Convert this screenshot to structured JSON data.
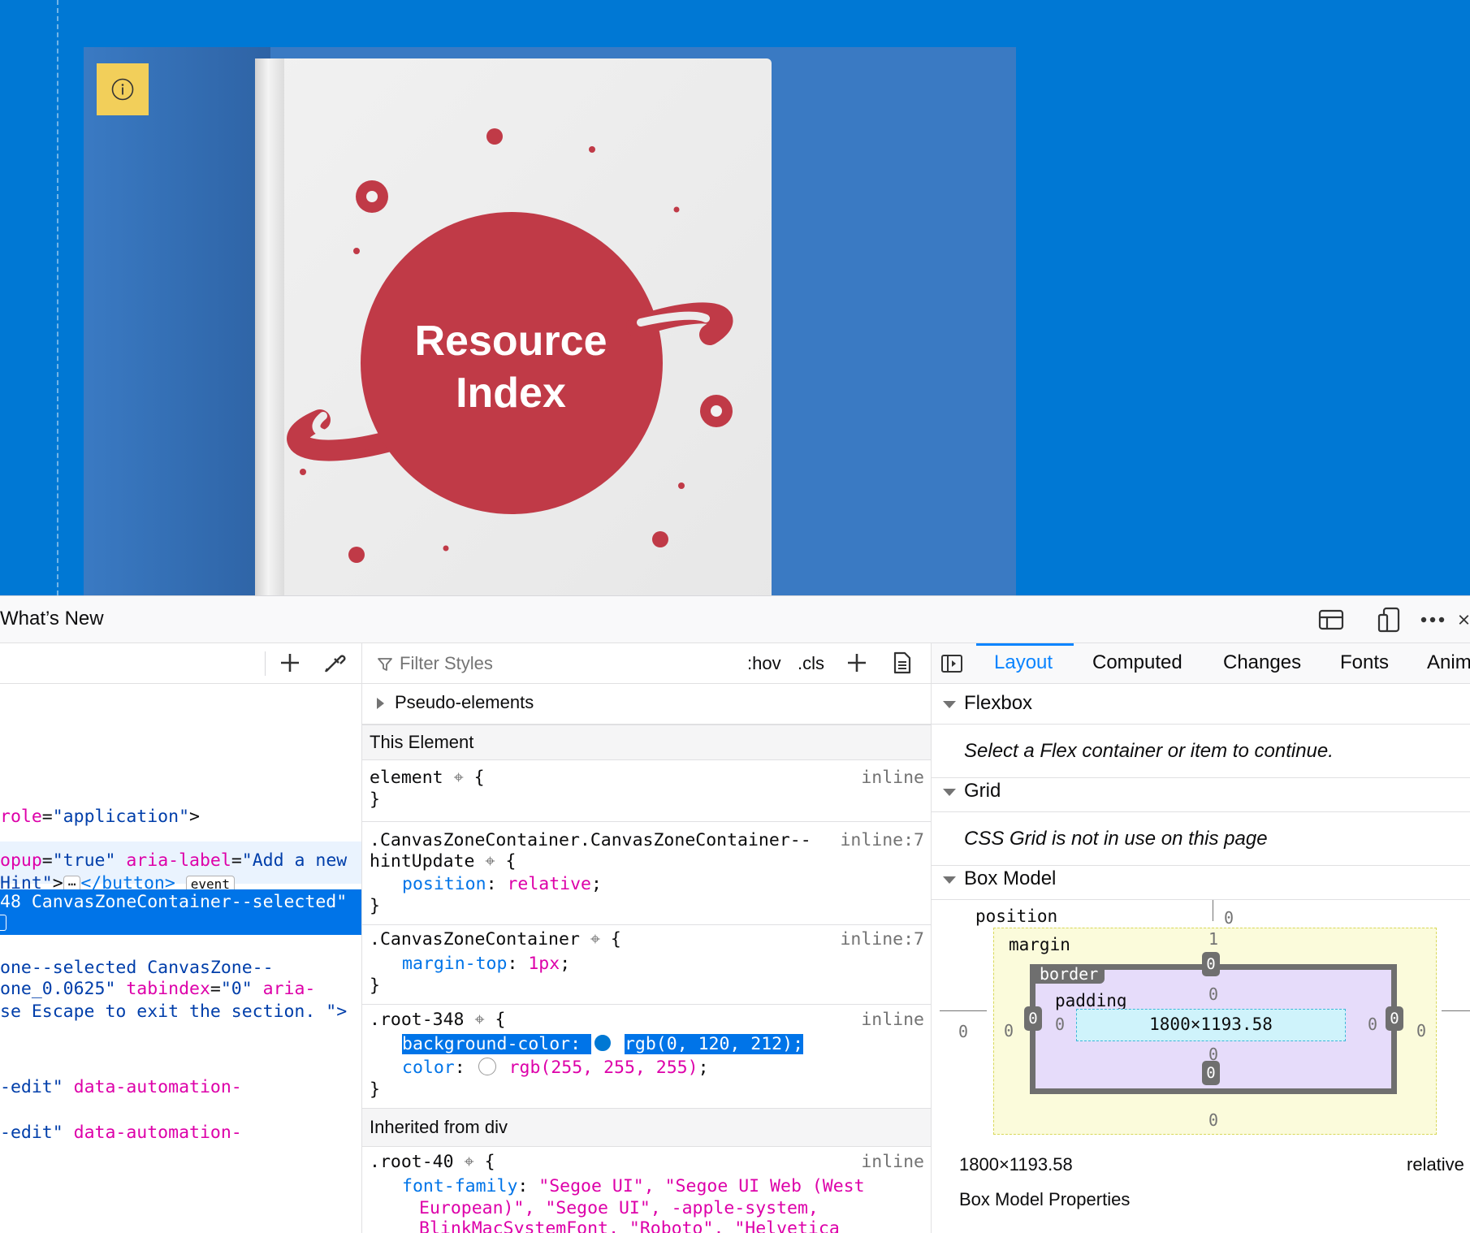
{
  "page": {
    "book_title_line1": "Resource",
    "book_title_line2": "Index",
    "hint_icon": "info-icon"
  },
  "toolbar": {
    "whats_new": "What’s New",
    "icons": [
      "dock-layout-icon",
      "responsive-design-icon",
      "more-options-icon",
      "close-icon"
    ]
  },
  "markup": {
    "lines": {
      "l1_attr": "role",
      "l1_val": "\"application\"",
      "l2_attr_a": "opup",
      "l2_val_a": "\"true\"",
      "l2_attr_b": "aria-label",
      "l2_val_b": "\"Add a new",
      "l3_val": "Hint\"",
      "l3_tag_close": "</button>",
      "l3_badge": "event",
      "l4_text": "48 CanvasZoneContainer--selected\"",
      "l5_val": "one--selected CanvasZone--",
      "l6_val": "one_0.0625\"",
      "l6_attr": "tabindex",
      "l6_val2": "\"0\"",
      "l6_attr2": "aria-",
      "l7_val": "se Escape to exit the section. \">",
      "l8_val": "-edit\"",
      "l8_attr": "data-automation-",
      "l9_val": "-edit\"",
      "l9_attr": "data-automation-"
    }
  },
  "rules": {
    "filter_placeholder": "Filter Styles",
    "hov": ":hov",
    "cls": ".cls",
    "pseudo_elements": "Pseudo-elements",
    "this_element": "This Element",
    "inherited": "Inherited from div",
    "r1_selector": "element",
    "r1_origin": "inline",
    "r2_selector_a": ".CanvasZoneContainer.CanvasZoneContainer--",
    "r2_selector_b": "hintUpdate",
    "r2_origin": "inline:7",
    "r2_prop": "position",
    "r2_val": "relative",
    "r3_selector": ".CanvasZoneContainer",
    "r3_origin": "inline:7",
    "r3_prop": "margin-top",
    "r3_val": "1px",
    "r4_selector": ".root-348",
    "r4_origin": "inline",
    "r4_prop1": "background-color:",
    "r4_val1": "rgb(0, 120, 212);",
    "r4_prop2": "color",
    "r4_val2": "rgb(255, 255, 255)",
    "r5_selector": ".root-40",
    "r5_origin": "inline",
    "r5_prop": "font-family",
    "r5_val_l1": "\"Segoe UI\", \"Segoe UI Web (West",
    "r5_val_l2": "European)\", \"Segoe UI\", -apple-system,",
    "r5_val_l3": "BlinkMacSystemFont, \"Roboto\", \"Helvetica",
    "swatch_bg": "#0078d4",
    "swatch_color": "#ffffff"
  },
  "layout": {
    "tabs": [
      "Layout",
      "Computed",
      "Changes",
      "Fonts",
      "Anim"
    ],
    "active_tab": "Layout",
    "flexbox": "Flexbox",
    "flexbox_msg": "Select a Flex container or item to continue.",
    "grid": "Grid",
    "grid_msg": "CSS Grid is not in use on this page",
    "box_model": "Box Model",
    "bm_position": "position",
    "bm_margin": "margin",
    "bm_border": "border",
    "bm_padding": "padding",
    "bm_content": "1800×1193.58",
    "bm_margin_top": "1",
    "bm_zero": "0",
    "footer_size": "1800×1193.58",
    "footer_position": "relative",
    "footer_cut": "Box Model Properties"
  },
  "colors": {
    "page_bg": "#0078d4",
    "book_accent": "#c03a47",
    "hint_bg": "#f2cf5a",
    "selection": "#0074e8"
  }
}
